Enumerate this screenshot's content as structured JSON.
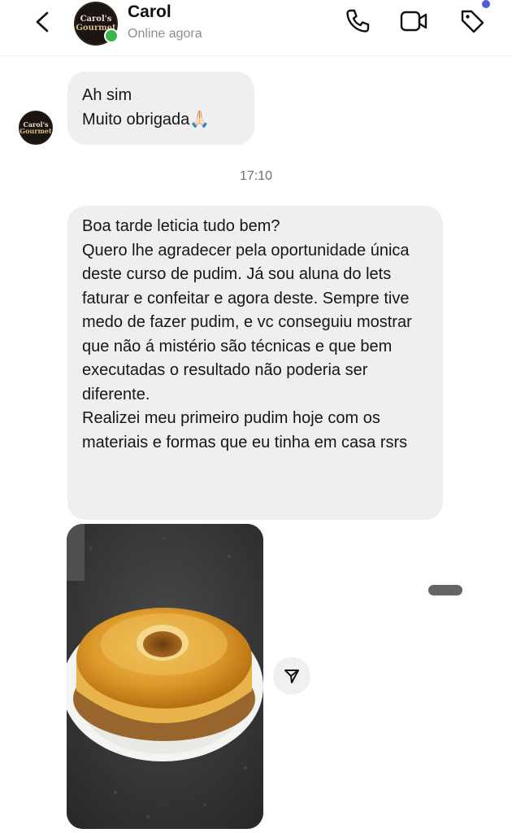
{
  "header": {
    "contact_name": "Carol",
    "status": "Online agora",
    "avatar": {
      "line1": "Carol's",
      "line2": "Gourmet"
    }
  },
  "messages": [
    {
      "type": "text",
      "lines": [
        "Ah sim",
        "Muito obrigada🙏🏻"
      ]
    },
    {
      "type": "timestamp",
      "text": "17:10"
    },
    {
      "type": "text",
      "paragraphs": [
        "Boa tarde leticia tudo bem?",
        "Quero lhe agradecer pela oportunidade única deste curso de pudim. Já sou aluna do lets faturar e confeitar e agora deste. Sempre tive medo de fazer pudim, e vc conseguiu mostrar que não á mistério são técnicas e que bem executadas o resultado não poderia ser diferente.",
        "Realizei meu primeiro pudim hoje com os materiais e formas que eu tinha em casa rsrs"
      ]
    },
    {
      "type": "image",
      "subject": "pudim-photo"
    }
  ],
  "icons": [
    "back-icon",
    "phone-icon",
    "video-icon",
    "tag-icon",
    "share-icon"
  ],
  "colors": {
    "bubble": "#efeff1",
    "online": "#3bb54a",
    "notification": "#4d5bd6"
  }
}
